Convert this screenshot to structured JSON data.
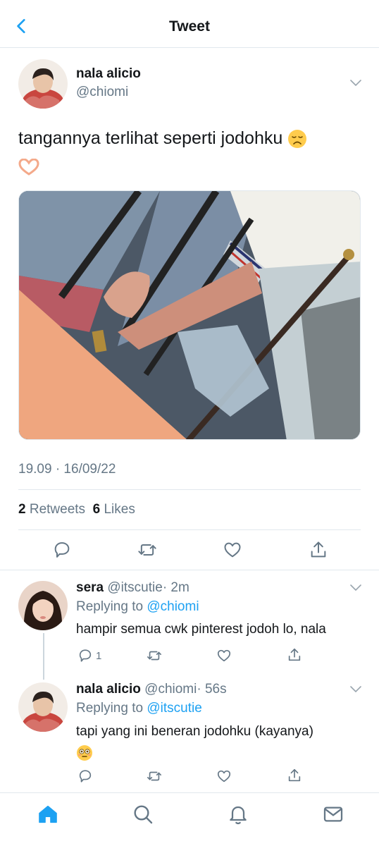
{
  "header": {
    "title": "Tweet"
  },
  "tweet": {
    "author_name": "nala alicio",
    "author_handle": "@chiomi",
    "text": "tangannya terlihat seperti jodohku",
    "timestamp": "19.09 · 16/09/22",
    "retweets_count": "2",
    "retweets_label": "Retweets",
    "likes_count": "6",
    "likes_label": "Likes"
  },
  "replies": [
    {
      "name": "sera",
      "handle": "@itscutie",
      "time": "· 2m",
      "replying_prefix": "Replying to",
      "replying_to": "@chiomi",
      "text": "hampir semua cwk pinterest jodoh lo, nala",
      "reply_count": "1"
    },
    {
      "name": "nala alicio",
      "handle": "@chiomi",
      "time": "· 56s",
      "replying_prefix": "Replying to",
      "replying_to": "@itscutie",
      "text": "tapi yang ini beneran jodohku (kayanya)"
    }
  ],
  "icons": {
    "back": "chevron-left-icon",
    "more": "chevron-down-icon",
    "reply": "speech-bubble-icon",
    "retweet": "retweet-icon",
    "like": "heart-icon",
    "share": "share-icon",
    "home": "home-icon",
    "search": "search-icon",
    "notifications": "bell-icon",
    "messages": "mail-icon"
  },
  "colors": {
    "accent": "#1da1f2",
    "secondary_text": "#657786",
    "divider": "#e1e8ed"
  }
}
